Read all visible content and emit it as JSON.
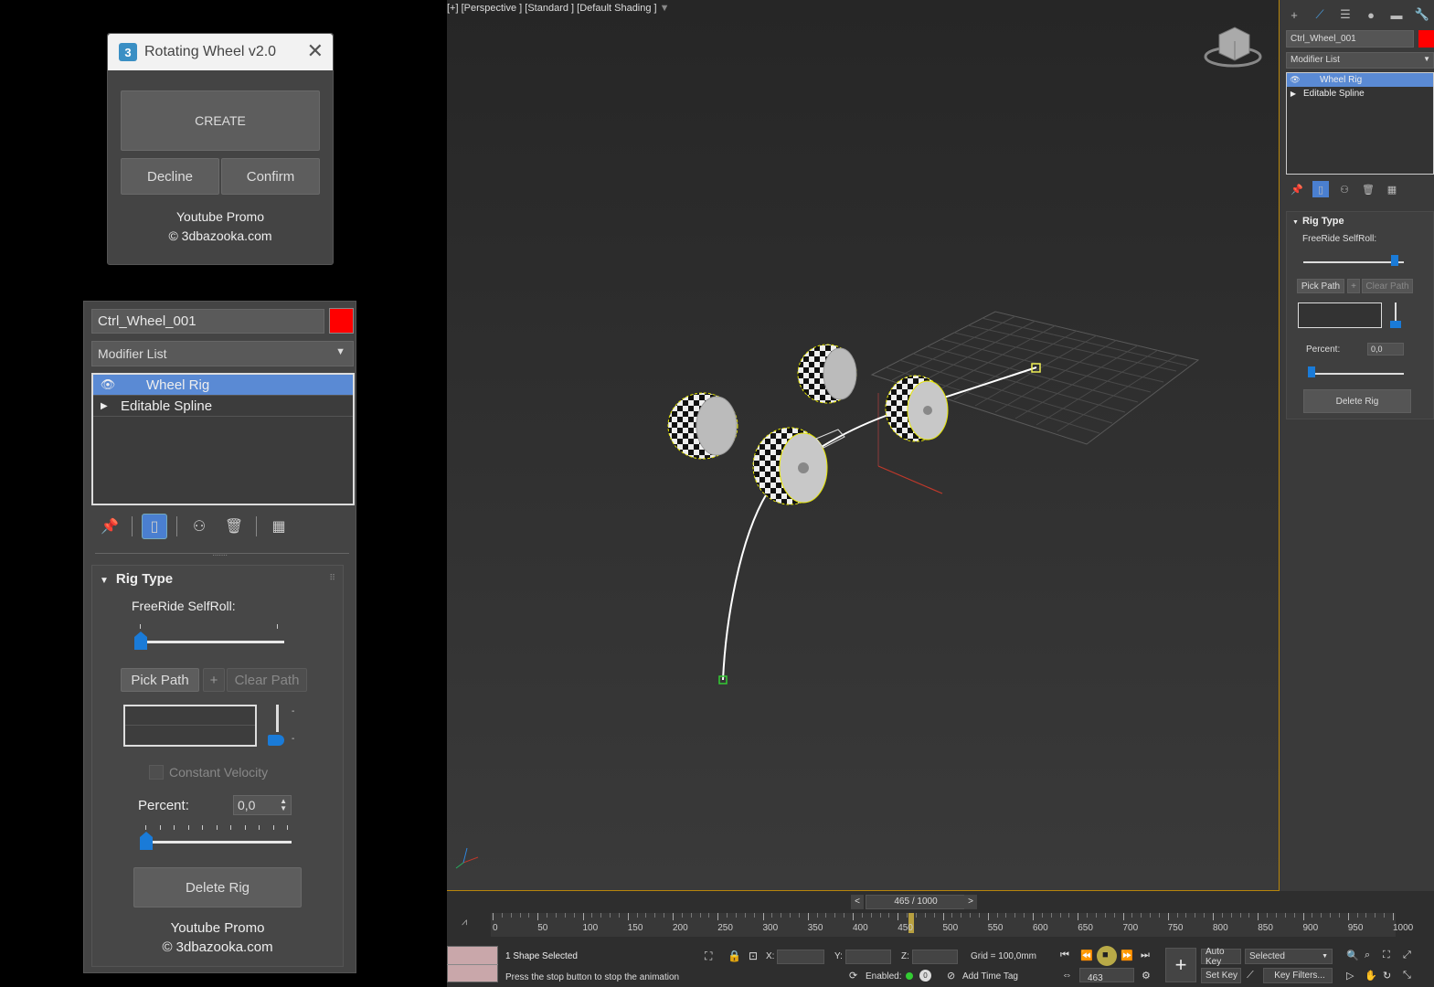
{
  "dialog": {
    "title": "Rotating Wheel v2.0",
    "app_icon": "3",
    "close_icon": "✕",
    "create_label": "CREATE",
    "decline_label": "Decline",
    "confirm_label": "Confirm",
    "promo_line1": "Youtube Promo",
    "promo_line2": "© 3dbazooka.com"
  },
  "panel": {
    "object_name": "Ctrl_Wheel_001",
    "object_color": "#ff0000",
    "modifier_list": "Modifier List",
    "stack": [
      {
        "label": "Wheel Rig",
        "selected": true
      },
      {
        "label": "Editable Spline",
        "selected": false
      }
    ],
    "rollout_title": "Rig Type",
    "freeride_label": "FreeRide SelfRoll:",
    "freeride_value": 0,
    "pick_path": "Pick Path",
    "plus": "+",
    "clear_path": "Clear Path",
    "constant_velocity": "Constant Velocity",
    "percent_label": "Percent:",
    "percent_value": "0,0",
    "delete_rig": "Delete Rig",
    "promo_line1": "Youtube Promo",
    "promo_line2": "© 3dbazooka.com"
  },
  "viewport": {
    "label": "[+] [Perspective ] [Standard ] [Default Shading ]"
  },
  "rpanel": {
    "object_name": "Ctrl_Wheel_001",
    "modifier_list": "Modifier List",
    "stack": [
      {
        "label": "Wheel Rig",
        "selected": true
      },
      {
        "label": "Editable Spline",
        "selected": false
      }
    ],
    "rollout_title": "Rig Type",
    "freeride_label": "FreeRide SelfRoll:",
    "pick_path": "Pick Path",
    "plus": "+",
    "clear_path": "Clear Path",
    "percent_label": "Percent:",
    "percent_value": "0,0",
    "delete_rig": "Delete Rig"
  },
  "timeline": {
    "frame_display": "465 / 1000",
    "prev": "<",
    "next": ">",
    "ticks": [
      "0",
      "50",
      "100",
      "150",
      "200",
      "250",
      "300",
      "350",
      "400",
      "450",
      "500",
      "550",
      "600",
      "650",
      "700",
      "750",
      "800",
      "850",
      "900",
      "950",
      "1000"
    ],
    "current_frame": 465,
    "total_frames": 1000
  },
  "status": {
    "selection": "1 Shape Selected",
    "prompt": "Press the stop button to stop the animation",
    "x_label": "X:",
    "y_label": "Y:",
    "z_label": "Z:",
    "grid": "Grid = 100,0mm",
    "enabled": "Enabled:",
    "add_time_tag": "Add Time Tag",
    "auto_key": "Auto Key",
    "set_key": "Set Key",
    "selected_dropdown": "Selected",
    "key_filters": "Key Filters...",
    "frame_field": "463"
  }
}
